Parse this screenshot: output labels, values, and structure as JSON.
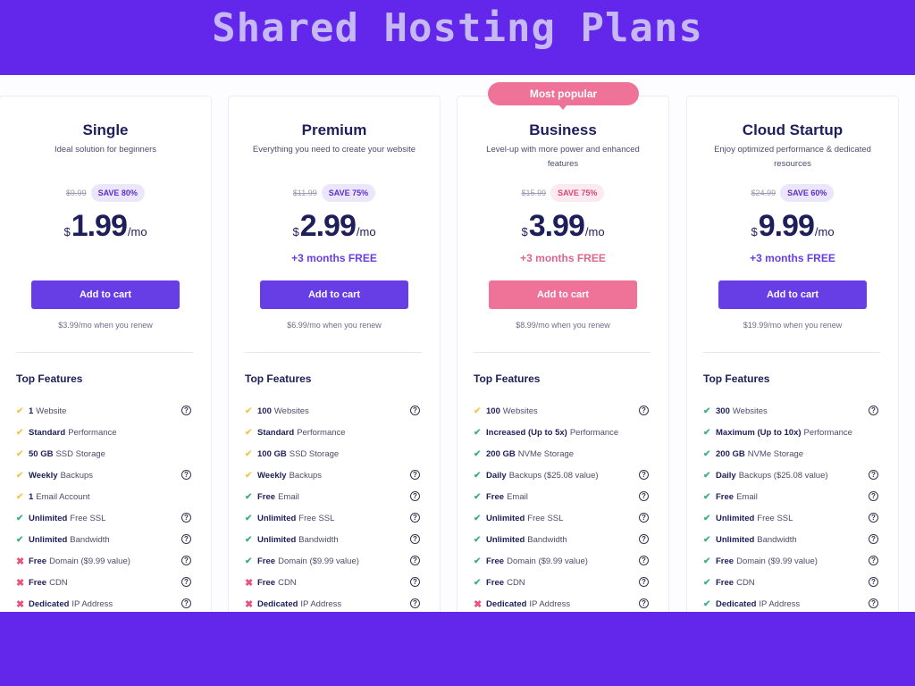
{
  "header": {
    "title": "Shared Hosting Plans"
  },
  "colors": {
    "band": "#6327ec",
    "brand_purple": "#673de6",
    "popular_pink": "#ef7299"
  },
  "popular_badge": "Most popular",
  "plans": [
    {
      "name": "Single",
      "description": "Ideal solution for beginners",
      "old_price": "$9.99",
      "save": "SAVE 80%",
      "currency": "$",
      "price": "1.99",
      "period": "/mo",
      "bonus": "",
      "cart_label": "Add to cart",
      "renew": "$3.99/mo when you renew",
      "features_title": "Top Features",
      "features": [
        {
          "mark": "check-yellow",
          "strong": "1",
          "text": "Website",
          "help": true
        },
        {
          "mark": "check-yellow",
          "strong": "Standard",
          "text": "Performance",
          "help": false
        },
        {
          "mark": "check-yellow",
          "strong": "50 GB",
          "text": "SSD Storage",
          "help": false
        },
        {
          "mark": "check-yellow",
          "strong": "Weekly",
          "text": "Backups",
          "help": true
        },
        {
          "mark": "check-yellow",
          "strong": "1",
          "text": "Email Account",
          "help": false
        },
        {
          "mark": "check-green",
          "strong": "Unlimited",
          "text": "Free SSL",
          "help": true
        },
        {
          "mark": "check-green",
          "strong": "Unlimited",
          "text": "Bandwidth",
          "help": true
        },
        {
          "mark": "cross-red",
          "strong": "Free",
          "text": "Domain ($9.99 value)",
          "help": true
        },
        {
          "mark": "cross-red",
          "strong": "Free",
          "text": "CDN",
          "help": true
        },
        {
          "mark": "cross-red",
          "strong": "Dedicated",
          "text": "IP Address",
          "help": true
        }
      ]
    },
    {
      "name": "Premium",
      "description": "Everything you need to create your website",
      "old_price": "$11.99",
      "save": "SAVE 75%",
      "currency": "$",
      "price": "2.99",
      "period": "/mo",
      "bonus": "+3 months FREE",
      "cart_label": "Add to cart",
      "renew": "$6.99/mo when you renew",
      "features_title": "Top Features",
      "features": [
        {
          "mark": "check-yellow",
          "strong": "100",
          "text": "Websites",
          "help": true
        },
        {
          "mark": "check-yellow",
          "strong": "Standard",
          "text": "Performance",
          "help": false
        },
        {
          "mark": "check-yellow",
          "strong": "100 GB",
          "text": "SSD Storage",
          "help": false
        },
        {
          "mark": "check-yellow",
          "strong": "Weekly",
          "text": "Backups",
          "help": true
        },
        {
          "mark": "check-green",
          "strong": "Free",
          "text": "Email",
          "help": true
        },
        {
          "mark": "check-green",
          "strong": "Unlimited",
          "text": "Free SSL",
          "help": true
        },
        {
          "mark": "check-green",
          "strong": "Unlimited",
          "text": "Bandwidth",
          "help": true
        },
        {
          "mark": "check-green",
          "strong": "Free",
          "text": "Domain ($9.99 value)",
          "help": true
        },
        {
          "mark": "cross-red",
          "strong": "Free",
          "text": "CDN",
          "help": true
        },
        {
          "mark": "cross-red",
          "strong": "Dedicated",
          "text": "IP Address",
          "help": true
        }
      ]
    },
    {
      "name": "Business",
      "description": "Level-up with more power and enhanced features",
      "old_price": "$15.99",
      "save": "SAVE 75%",
      "currency": "$",
      "price": "3.99",
      "period": "/mo",
      "bonus": "+3 months FREE",
      "cart_label": "Add to cart",
      "renew": "$8.99/mo when you renew",
      "features_title": "Top Features",
      "features": [
        {
          "mark": "check-yellow",
          "strong": "100",
          "text": "Websites",
          "help": true
        },
        {
          "mark": "check-green",
          "strong": "Increased (Up to 5x)",
          "text": "Performance",
          "help": false
        },
        {
          "mark": "check-green",
          "strong": "200 GB",
          "text": "NVMe Storage",
          "help": false
        },
        {
          "mark": "check-green",
          "strong": "Daily",
          "text": "Backups ($25.08 value)",
          "help": true
        },
        {
          "mark": "check-green",
          "strong": "Free",
          "text": "Email",
          "help": true
        },
        {
          "mark": "check-green",
          "strong": "Unlimited",
          "text": "Free SSL",
          "help": true
        },
        {
          "mark": "check-green",
          "strong": "Unlimited",
          "text": "Bandwidth",
          "help": true
        },
        {
          "mark": "check-green",
          "strong": "Free",
          "text": "Domain ($9.99 value)",
          "help": true
        },
        {
          "mark": "check-green",
          "strong": "Free",
          "text": "CDN",
          "help": true
        },
        {
          "mark": "cross-red",
          "strong": "Dedicated",
          "text": "IP Address",
          "help": true
        }
      ]
    },
    {
      "name": "Cloud Startup",
      "description": "Enjoy optimized performance & dedicated resources",
      "old_price": "$24.99",
      "save": "SAVE 60%",
      "currency": "$",
      "price": "9.99",
      "period": "/mo",
      "bonus": "+3 months FREE",
      "cart_label": "Add to cart",
      "renew": "$19.99/mo when you renew",
      "features_title": "Top Features",
      "features": [
        {
          "mark": "check-green",
          "strong": "300",
          "text": "Websites",
          "help": true
        },
        {
          "mark": "check-green",
          "strong": "Maximum (Up to 10x)",
          "text": "Performance",
          "help": false
        },
        {
          "mark": "check-green",
          "strong": "200 GB",
          "text": "NVMe Storage",
          "help": false
        },
        {
          "mark": "check-green",
          "strong": "Daily",
          "text": "Backups ($25.08 value)",
          "help": true
        },
        {
          "mark": "check-green",
          "strong": "Free",
          "text": "Email",
          "help": true
        },
        {
          "mark": "check-green",
          "strong": "Unlimited",
          "text": "Free SSL",
          "help": true
        },
        {
          "mark": "check-green",
          "strong": "Unlimited",
          "text": "Bandwidth",
          "help": true
        },
        {
          "mark": "check-green",
          "strong": "Free",
          "text": "Domain ($9.99 value)",
          "help": true
        },
        {
          "mark": "check-green",
          "strong": "Free",
          "text": "CDN",
          "help": true
        },
        {
          "mark": "check-green",
          "strong": "Dedicated",
          "text": "IP Address",
          "help": true
        }
      ]
    }
  ]
}
